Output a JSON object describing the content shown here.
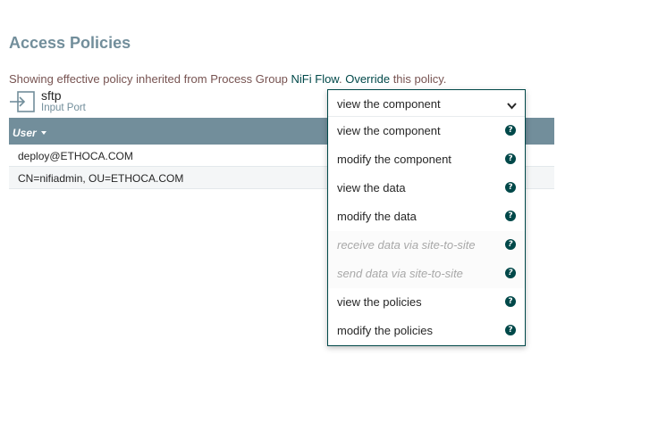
{
  "page": {
    "title": "Access Policies"
  },
  "policy_message": {
    "prefix": "Showing effective policy inherited from Process Group ",
    "group_link": "NiFi Flow",
    "separator": ". ",
    "override_link": "Override",
    "suffix": " this policy."
  },
  "component": {
    "name": "sftp",
    "type": "Input Port",
    "icon": "input-port-icon"
  },
  "users_table": {
    "columns": [
      {
        "label": "User",
        "sort": "descending"
      }
    ],
    "rows": [
      {
        "user": "deploy@ETHOCA.COM"
      },
      {
        "user": "CN=nifiadmin, OU=ETHOCA.COM"
      }
    ]
  },
  "policy_select": {
    "selected": "view the component",
    "options": [
      {
        "label": "view the component",
        "enabled": true,
        "icon": "help-icon"
      },
      {
        "label": "modify the component",
        "enabled": true,
        "icon": "help-icon"
      },
      {
        "label": "view the data",
        "enabled": true,
        "icon": "help-icon"
      },
      {
        "label": "modify the data",
        "enabled": true,
        "icon": "help-icon"
      },
      {
        "label": "receive data via site-to-site",
        "enabled": false,
        "icon": "help-icon"
      },
      {
        "label": "send data via site-to-site",
        "enabled": false,
        "icon": "help-icon"
      },
      {
        "label": "view the policies",
        "enabled": true,
        "icon": "help-icon"
      },
      {
        "label": "modify the policies",
        "enabled": true,
        "icon": "help-icon"
      }
    ],
    "help_glyph": "?"
  },
  "colors": {
    "title": "#728e9b",
    "message": "#775351",
    "link": "#004849",
    "table_header": "#728e9b",
    "accent": "#004849",
    "disabled_text": "#a8a8a8"
  }
}
